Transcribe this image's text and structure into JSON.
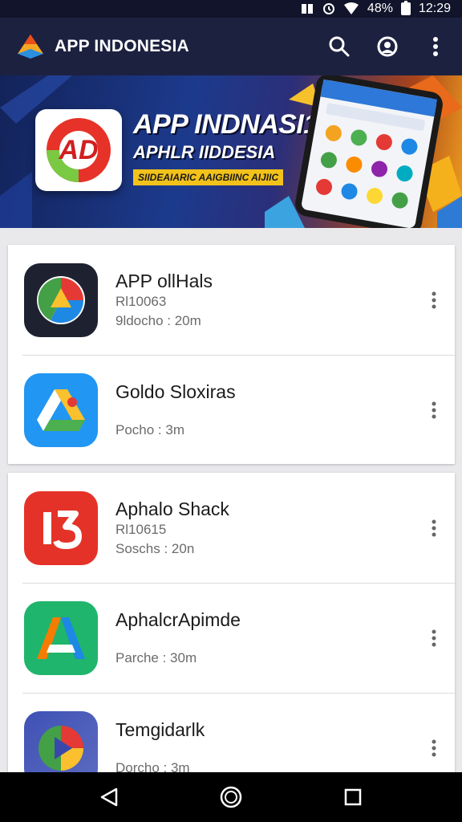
{
  "status_bar": {
    "battery": "48%",
    "time": "12:29",
    "icons": [
      "sim-icon",
      "alarm-icon",
      "wifi-icon",
      "battery-icon"
    ]
  },
  "app_bar": {
    "title": "APP INDONESIA",
    "actions": [
      "search-icon",
      "account-icon",
      "more-vert-icon"
    ]
  },
  "banner": {
    "title": "APP INDNASI1",
    "subtitle": "APHLR IIDDESIA",
    "tagline": "SIIDEAIARIC AAIGBIINC AIJIIC",
    "logo_text": "AD"
  },
  "colors": {
    "app_bar": "#1d2140",
    "card": "#ffffff",
    "background": "#e9e9ec"
  },
  "app_list": {
    "group1": [
      {
        "name": "APP ollHals",
        "line1": "Rl10063",
        "line2": "9ldocho : 20m",
        "icon": "pie-chart-icon"
      },
      {
        "name": "Goldo Sloxiras",
        "line1": "",
        "line2": "Pocho : 3m",
        "icon": "drive-triangle-icon"
      }
    ],
    "group2": [
      {
        "name": "Aphalo Shack",
        "line1": "Rl10615",
        "line2": "Soschs : 20n",
        "icon": "number-13-icon"
      },
      {
        "name": "AphalcrApimde",
        "line1": "",
        "line2": "Parche : 30m",
        "icon": "letter-a-icon"
      },
      {
        "name": "Temgidarlk",
        "line1": "",
        "line2": "Dorcho : 3m",
        "icon": "play-triangle-icon"
      }
    ]
  },
  "nav_bar": {
    "buttons": [
      "back-icon",
      "home-icon",
      "recents-icon"
    ]
  }
}
